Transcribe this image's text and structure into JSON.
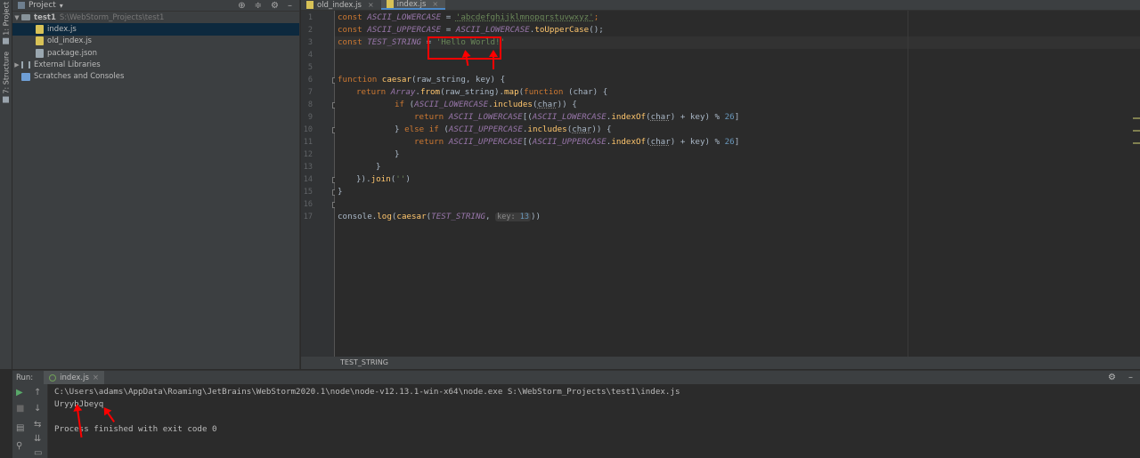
{
  "left_strip": {
    "tab1": "1: Project",
    "tab2": "7: Structure"
  },
  "project": {
    "title": "Project",
    "items": [
      {
        "label": "test1",
        "path": "S:\\WebStorm_Projects\\test1"
      },
      {
        "label": "index.js"
      },
      {
        "label": "old_index.js"
      },
      {
        "label": "package.json"
      },
      {
        "label": "External Libraries"
      },
      {
        "label": "Scratches and Consoles"
      }
    ]
  },
  "editor": {
    "tabs": [
      {
        "label": "old_index.js"
      },
      {
        "label": "index.js"
      }
    ],
    "line_numbers": [
      "1",
      "2",
      "3",
      "4",
      "5",
      "6",
      "7",
      "8",
      "9",
      "10",
      "11",
      "12",
      "13",
      "14",
      "15",
      "16",
      "17"
    ],
    "code": {
      "l1_kw": "const ",
      "l1_const": "ASCII_LOWERCASE",
      "l1_eq": " = ",
      "l1_str": "'abcdefghijklmnopqrstuvwxyz'",
      "l1_end": ";",
      "l2_kw": "const ",
      "l2_const": "ASCII_UPPERCASE",
      "l2_eq": " = ",
      "l2_ref": "ASCII_LOWERCASE",
      "l2_dot": ".",
      "l2_fn": "toUpperCase",
      "l2_end": "();",
      "l3_kw": "const ",
      "l3_const": "TEST_STRING",
      "l3_eq": " = ",
      "l3_str": "'Hello World!'",
      "l6_kw": "function ",
      "l6_fn": "caesar",
      "l6_rest": "(raw_string, key) {",
      "l7_kw": "return ",
      "l7_cls": "Array",
      "l7_dot": ".",
      "l7_fn1": "from",
      "l7_mid": "(raw_string).",
      "l7_fn2": "map",
      "l7_p": "(",
      "l7_kw2": "function",
      "l7_rest": " (char) {",
      "l8_kw": "if ",
      "l8_p": "(",
      "l8_const": "ASCII_LOWERCASE",
      "l8_dot": ".",
      "l8_fn": "includes",
      "l8_p2": "(",
      "l8_arg": "char",
      "l8_end": ")) {",
      "l9_kw": "return ",
      "l9_const": "ASCII_LOWERCASE",
      "l9_b": "[(",
      "l9_const2": "ASCII_LOWERCASE",
      "l9_dot": ".",
      "l9_fn": "indexOf",
      "l9_p": "(",
      "l9_arg": "char",
      "l9_mid": ") + key) % ",
      "l9_num": "26",
      "l9_end": "]",
      "l10_pre": "} ",
      "l10_kw": "else if ",
      "l10_p": "(",
      "l10_const": "ASCII_UPPERCASE",
      "l10_dot": ".",
      "l10_fn": "includes",
      "l10_p2": "(",
      "l10_arg": "char",
      "l10_end": ")) {",
      "l11_kw": "return ",
      "l11_const": "ASCII_UPPERCASE",
      "l11_b": "[(",
      "l11_const2": "ASCII_UPPERCASE",
      "l11_dot": ".",
      "l11_fn": "indexOf",
      "l11_p": "(",
      "l11_arg": "char",
      "l11_mid": ") + key) % ",
      "l11_num": "26",
      "l11_end": "]",
      "l12": "}",
      "l13": "}",
      "l14_pre": "}).",
      "l14_fn": "join",
      "l14_p": "(",
      "l14_str": "''",
      "l14_end": ")",
      "l15": "}",
      "l17_pre": "console.",
      "l17_fn": "log",
      "l17_p": "(",
      "l17_fn2": "caesar",
      "l17_p2": "(",
      "l17_const": "TEST_STRING",
      "l17_c": ", ",
      "l17_hint": "key: ",
      "l17_num": "13",
      "l17_end": "))"
    },
    "breadcrumb": "TEST_STRING"
  },
  "run": {
    "label": "Run:",
    "tab": "index.js",
    "output": [
      "C:\\Users\\adams\\AppData\\Roaming\\JetBrains\\WebStorm2020.1\\node\\node-v12.13.1-win-x64\\node.exe S:\\WebStorm_Projects\\test1\\index.js",
      "UryybJbeyq",
      "",
      "Process finished with exit code 0"
    ]
  },
  "colors": {
    "background": "#2b2b2b",
    "panel": "#3c3f41",
    "selection": "#0d293e",
    "annotation": "#ff0000"
  }
}
